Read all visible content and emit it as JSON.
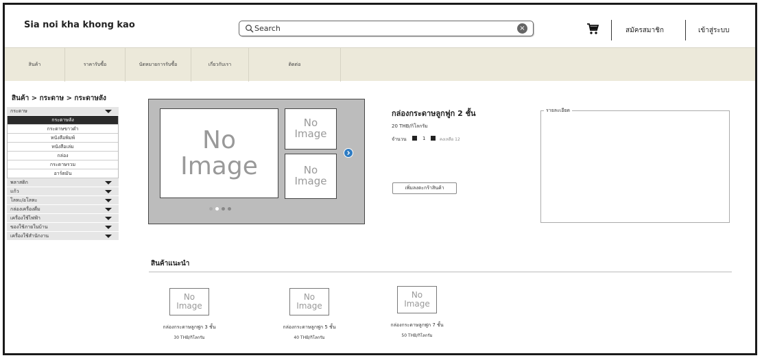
{
  "header": {
    "logo": "Sia noi kha khong kao",
    "search_placeholder": "Search",
    "clear_glyph": "×",
    "signup_label": "สมัครสมาชิก",
    "login_label": "เข้าสู่ระบบ"
  },
  "nav": {
    "items": [
      "สินค้า",
      "ราคารับซื้อ",
      "นัดหมายการรับซื้อ",
      "เกี่ยวกับเรา",
      "ติดต่อ"
    ]
  },
  "breadcrumb": "สินค้า > กระดาษ > กระดาษลัง",
  "sidebar": {
    "open_category": "กระดาษ",
    "sub_items": [
      "กระดาษลัง",
      "กระดาษขาวดำ",
      "หนังสือพิมพ์",
      "หนังสือเล่ม",
      "กล่อง",
      "กระดาษรวม",
      "อาร์ตมัน"
    ],
    "active_sub": "กระดาษลัง",
    "other_categories": [
      "พลาสติก",
      "แก้ว",
      "โลหะ/อโลหะ",
      "กล่องเครื่องดื่ม",
      "เครื่องใช้ไฟฟ้า",
      "ของใช้ภายในบ้าน",
      "เครื่องใช้สำนักงาน"
    ]
  },
  "gallery": {
    "placeholder_line1": "No",
    "placeholder_line2": "Image"
  },
  "product": {
    "title": "กล่องกระดาษลูกฟูก 2 ชั้น",
    "price": "20 THB/กิโลกรัม",
    "qty_label": "จำนวน",
    "qty_value": "1",
    "stock_text": "คงเหลือ 12",
    "add_to_cart": "เพิ่มลงตะกร้าสินค้า"
  },
  "detail": {
    "legend": "รายละเอียด"
  },
  "recommended": {
    "title": "สินค้าแนะนำ",
    "items": [
      {
        "name": "กล่องกระดาษลูกฟูก 3 ชั้น",
        "price": "30 THB/กิโลกรัม"
      },
      {
        "name": "กล่องกระดาษลูกฟูก 5 ชั้น",
        "price": "40 THB/กิโลกรัม"
      },
      {
        "name": "กล่องกระดาษลูกฟูก 7 ชั้น",
        "price": "50 THB/กิโลกรัม"
      }
    ]
  },
  "icons": {
    "search": "search-icon",
    "clear": "clear-icon",
    "cart": "cart-icon",
    "dropdown": "chevron-down-icon",
    "next": "chevron-right-icon"
  },
  "colors": {
    "nav_bg": "#ece9da",
    "active_bg": "#2b2b2b",
    "gallery_bg": "#bcbcbc",
    "next_button": "#2e7cc3"
  },
  "carousel": {
    "slide_count": 4,
    "active_index": 1
  }
}
